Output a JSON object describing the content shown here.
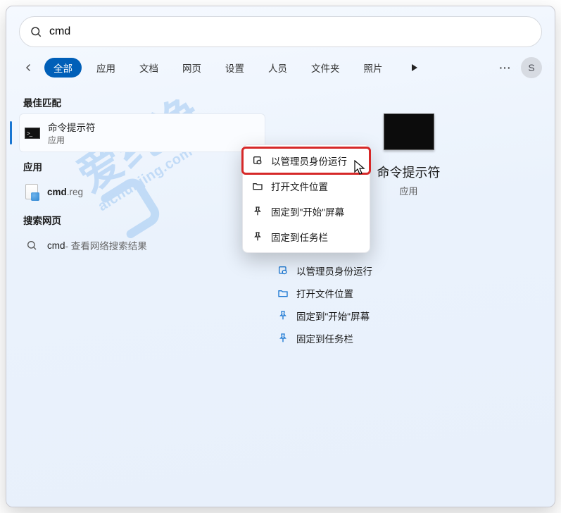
{
  "watermark": {
    "cn": "爱纯净",
    "en": "aichunjing.com"
  },
  "search": {
    "value": "cmd",
    "placeholder": ""
  },
  "tabs": [
    "全部",
    "应用",
    "文档",
    "网页",
    "设置",
    "人员",
    "文件夹",
    "照片"
  ],
  "avatar_initial": "S",
  "left": {
    "best_header": "最佳匹配",
    "best": {
      "title": "命令提示符",
      "subtitle": "应用"
    },
    "apps_header": "应用",
    "apps": [
      {
        "name": "cmd",
        "ext": ".reg"
      }
    ],
    "web_header": "搜索网页",
    "web": {
      "term": "cmd",
      "suffix": " - 查看网络搜索结果"
    }
  },
  "context_menu": {
    "items": [
      "以管理员身份运行",
      "打开文件位置",
      "固定到\"开始\"屏幕",
      "固定到任务栏"
    ],
    "highlight_index": 0
  },
  "preview": {
    "title": "命令提示符",
    "subtitle": "应用",
    "actions": [
      "以管理员身份运行",
      "打开文件位置",
      "固定到\"开始\"屏幕",
      "固定到任务栏"
    ]
  }
}
